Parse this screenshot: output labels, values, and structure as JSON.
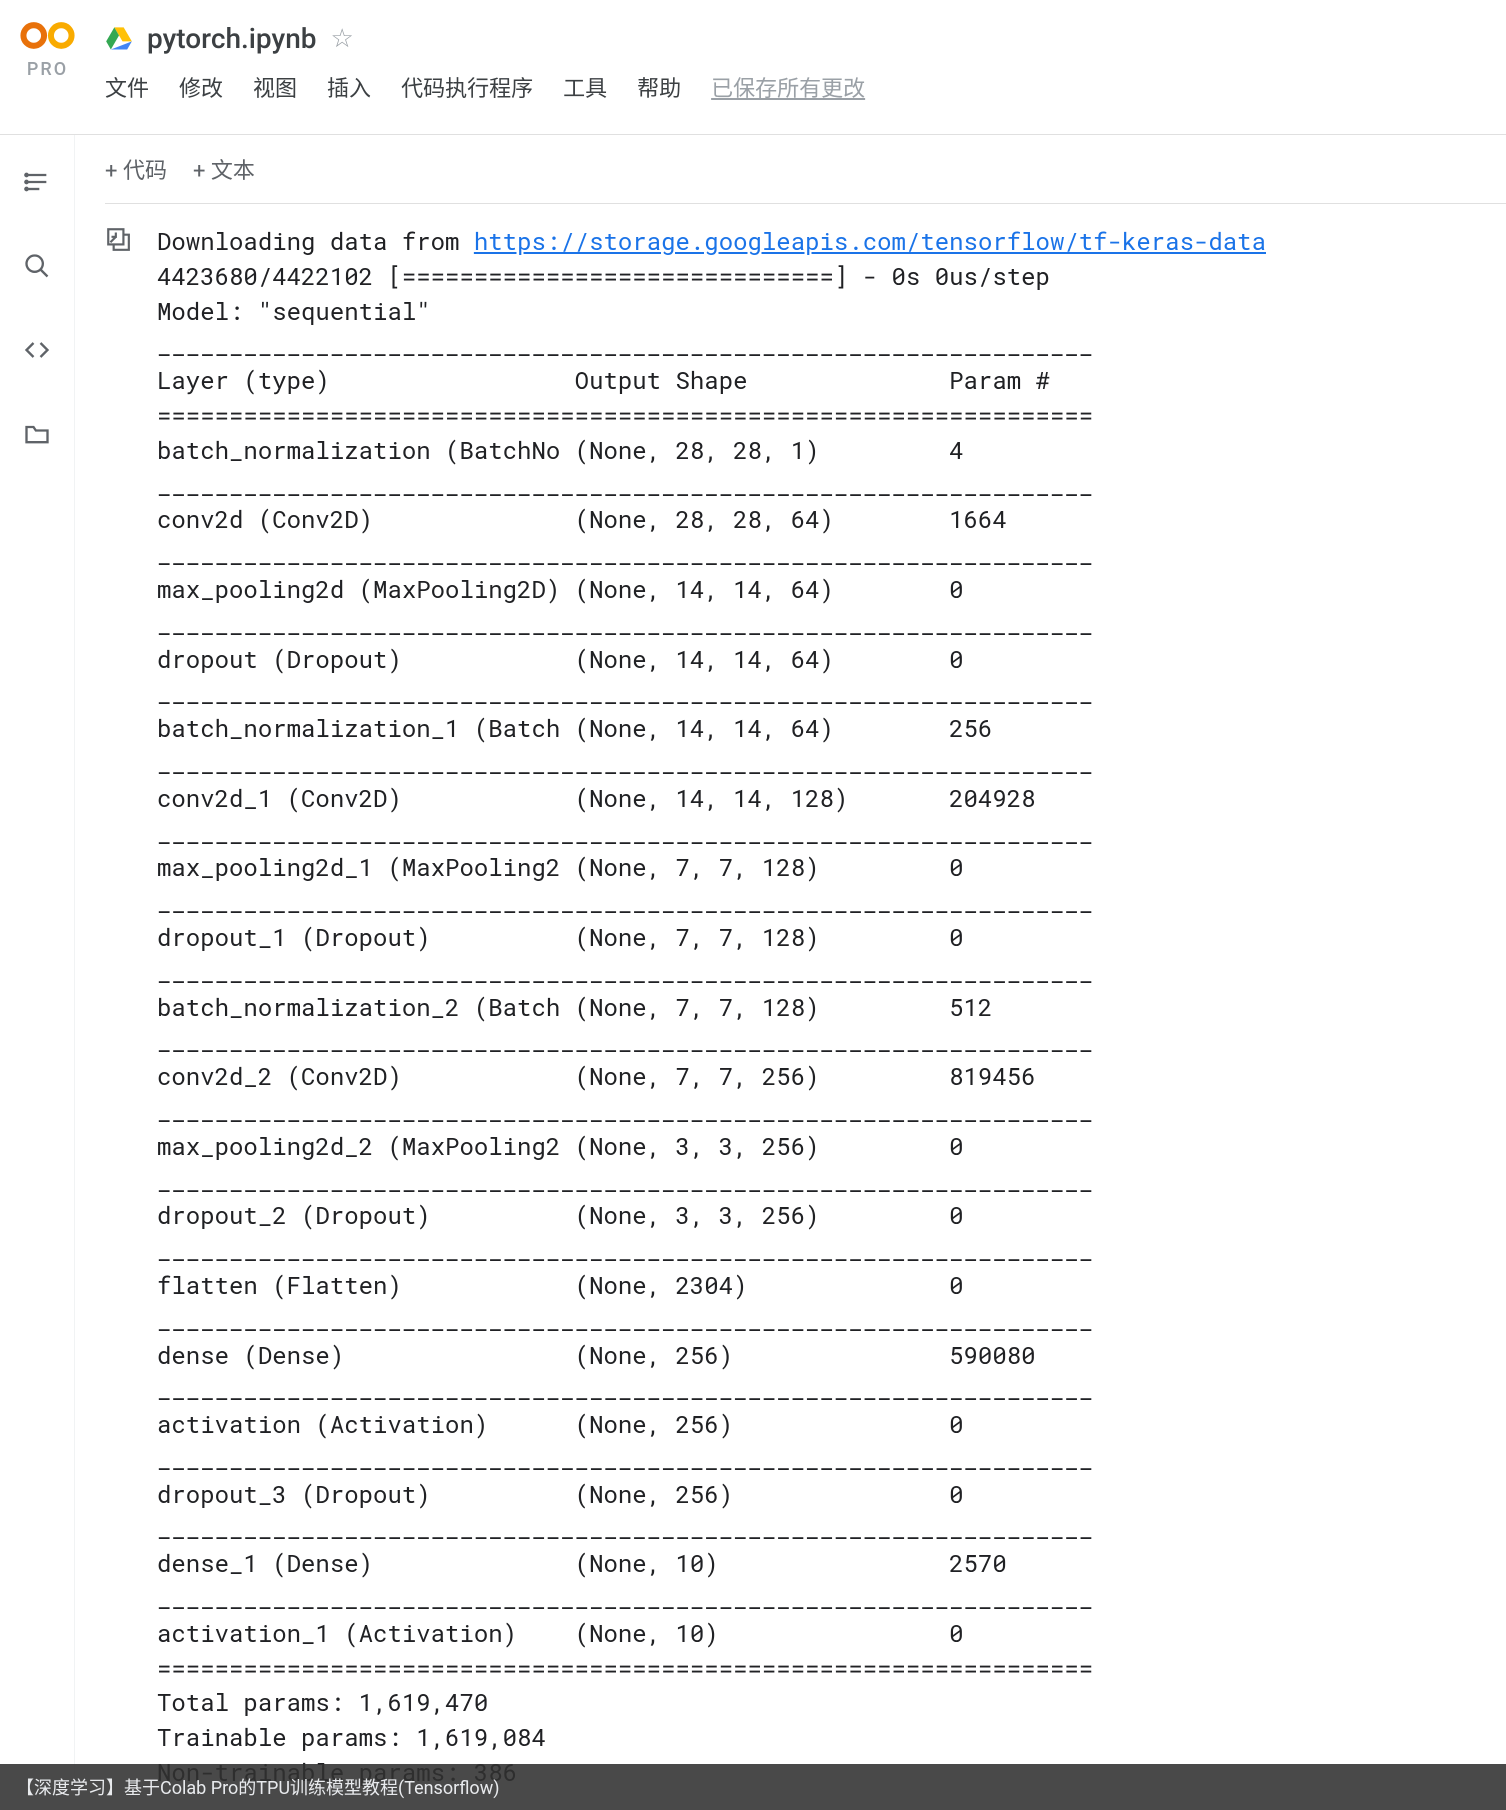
{
  "header": {
    "pro_label": "PRO",
    "title": "pytorch.ipynb",
    "menu": [
      "文件",
      "修改",
      "视图",
      "插入",
      "代码执行程序",
      "工具",
      "帮助"
    ],
    "save_status": "已保存所有更改"
  },
  "toolbar": {
    "add_code": "+ 代码",
    "add_text": "+ 文本"
  },
  "output": {
    "download_prefix": "Downloading data from ",
    "download_url": "https://storage.googleapis.com/tensorflow/tf-keras-data",
    "progress_line": "4423680/4422102 [==============================] - 0s 0us/step",
    "model_line": "Model: \"sequential\"",
    "sep_thin": "_________________________________________________________________",
    "sep_thick": "=================================================================",
    "header_layer": "Layer (type)",
    "header_output": "Output Shape",
    "header_param": "Param #",
    "layers": [
      {
        "name": "batch_normalization (BatchNo",
        "shape": "(None, 28, 28, 1)",
        "params": "4"
      },
      {
        "name": "conv2d (Conv2D)",
        "shape": "(None, 28, 28, 64)",
        "params": "1664"
      },
      {
        "name": "max_pooling2d (MaxPooling2D)",
        "shape": "(None, 14, 14, 64)",
        "params": "0"
      },
      {
        "name": "dropout (Dropout)",
        "shape": "(None, 14, 14, 64)",
        "params": "0"
      },
      {
        "name": "batch_normalization_1 (Batch",
        "shape": "(None, 14, 14, 64)",
        "params": "256"
      },
      {
        "name": "conv2d_1 (Conv2D)",
        "shape": "(None, 14, 14, 128)",
        "params": "204928"
      },
      {
        "name": "max_pooling2d_1 (MaxPooling2",
        "shape": "(None, 7, 7, 128)",
        "params": "0"
      },
      {
        "name": "dropout_1 (Dropout)",
        "shape": "(None, 7, 7, 128)",
        "params": "0"
      },
      {
        "name": "batch_normalization_2 (Batch",
        "shape": "(None, 7, 7, 128)",
        "params": "512"
      },
      {
        "name": "conv2d_2 (Conv2D)",
        "shape": "(None, 7, 7, 256)",
        "params": "819456"
      },
      {
        "name": "max_pooling2d_2 (MaxPooling2",
        "shape": "(None, 3, 3, 256)",
        "params": "0"
      },
      {
        "name": "dropout_2 (Dropout)",
        "shape": "(None, 3, 3, 256)",
        "params": "0"
      },
      {
        "name": "flatten (Flatten)",
        "shape": "(None, 2304)",
        "params": "0"
      },
      {
        "name": "dense (Dense)",
        "shape": "(None, 256)",
        "params": "590080"
      },
      {
        "name": "activation (Activation)",
        "shape": "(None, 256)",
        "params": "0"
      },
      {
        "name": "dropout_3 (Dropout)",
        "shape": "(None, 256)",
        "params": "0"
      },
      {
        "name": "dense_1 (Dense)",
        "shape": "(None, 10)",
        "params": "2570"
      },
      {
        "name": "activation_1 (Activation)",
        "shape": "(None, 10)",
        "params": "0"
      }
    ],
    "total_params": "Total params: 1,619,470",
    "trainable_params": "Trainable params: 1,619,084",
    "non_trainable_params": "Non-trainable params: 386"
  },
  "footer": {
    "left": "【深度学习】基于Colab Pro的TPU训练模型教程(Tensorflow)",
    "right": ""
  },
  "colors": {
    "accent_orange": "#f9ab00",
    "link_blue": "#1a73e8",
    "drive_yellow": "#ffc107",
    "drive_green": "#34a853",
    "drive_blue": "#4285f4"
  }
}
